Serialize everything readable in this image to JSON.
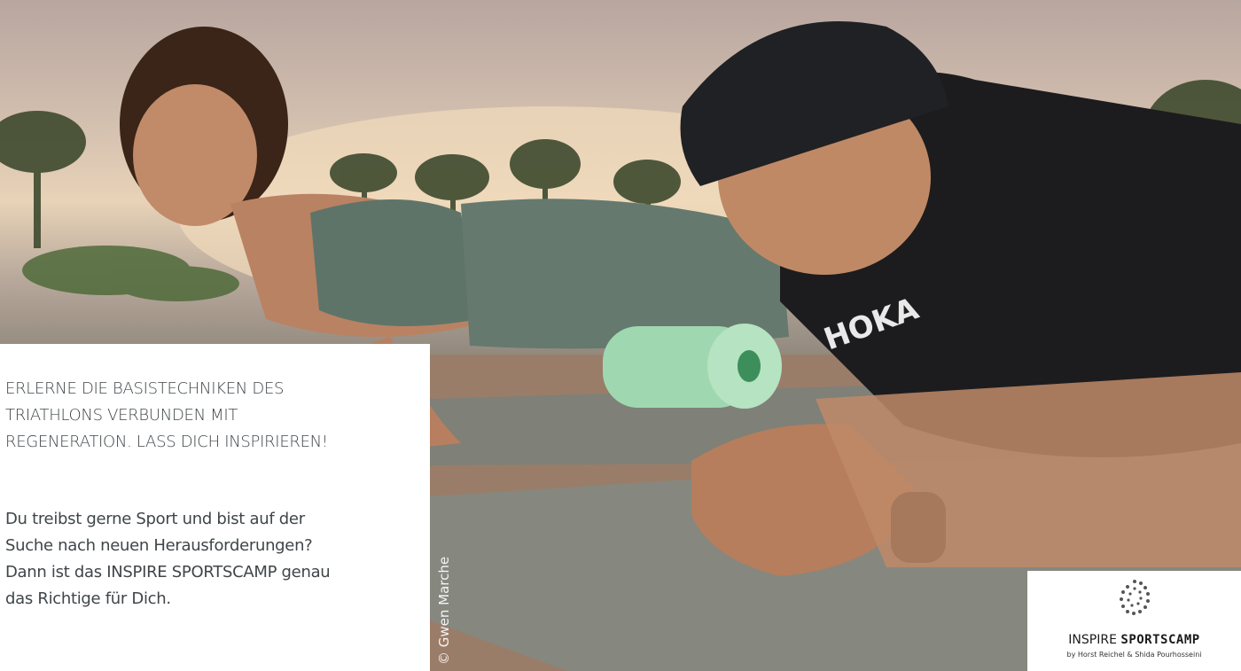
{
  "hero": {
    "photo_credit": "© Gwen Marche",
    "logo_icon": "spiral-dots-icon"
  },
  "intro": {
    "headline_lines": [
      "ERLERNE DIE BASISTECHNIKEN DES",
      "TRIATHLONS VERBUNDEN MIT",
      "REGENERATION. LASS DICH INSPIRIEREN!"
    ],
    "body_lines": [
      "Du treibst gerne Sport und bist auf der",
      "Suche nach neuen Herausforderungen?",
      "Dann ist das INSPIRE SPORTSCAMP genau",
      "das Richtige für Dich."
    ]
  },
  "logo": {
    "name_light": "INSPIRE",
    "name_bold": "SPORTSCAMP",
    "byline": "by Horst Reichel & Shida Pourhosseini"
  },
  "colors": {
    "text": "#3f4548",
    "panel": "#ffffff"
  }
}
